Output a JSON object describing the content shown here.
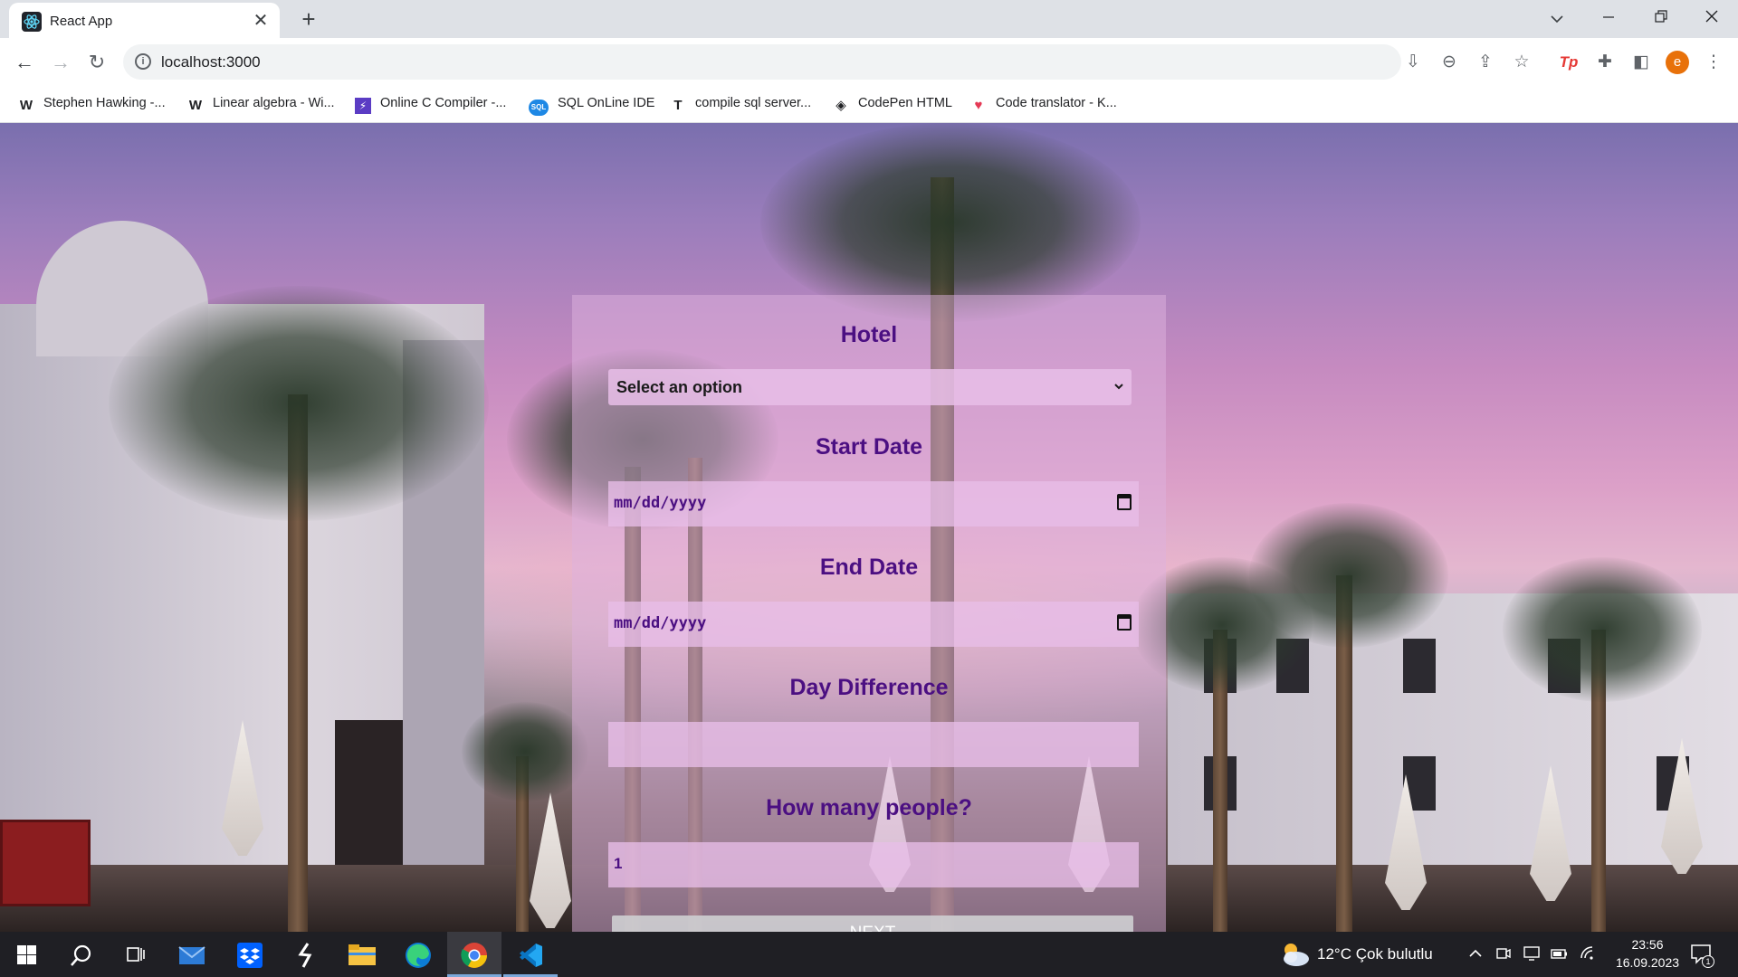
{
  "browser": {
    "tab": {
      "title": "React App",
      "favicon": "react-icon",
      "close_glyph": "✕"
    },
    "new_tab_glyph": "+",
    "url": "localhost:3000",
    "bookmarks": [
      {
        "label": "Stephen Hawking -...",
        "icon": "W"
      },
      {
        "label": "Linear algebra - Wi...",
        "icon": "W"
      },
      {
        "label": "Online C Compiler -...",
        "icon": "⚡"
      },
      {
        "label": "SQL OnLine IDE",
        "icon": "SQL"
      },
      {
        "label": "compile sql server...",
        "icon": "T"
      },
      {
        "label": "CodePen HTML",
        "icon": "◈"
      },
      {
        "label": "Code translator - K...",
        "icon": "♥"
      }
    ],
    "profile_initial": "e"
  },
  "form": {
    "hotel_label": "Hotel",
    "hotel_select_value": "Select an option",
    "start_date_label": "Start Date",
    "start_date_value": "mm/dd/yyyy",
    "end_date_label": "End Date",
    "end_date_value": "mm/dd/yyyy",
    "day_difference_label": "Day Difference",
    "day_difference_value": "",
    "people_label": "How many people?",
    "people_value": "1",
    "next_label": "NEXT"
  },
  "taskbar": {
    "weather": "12°C  Çok bulutlu",
    "time": "23:56",
    "date": "16.09.2023",
    "notification_count": "1"
  }
}
